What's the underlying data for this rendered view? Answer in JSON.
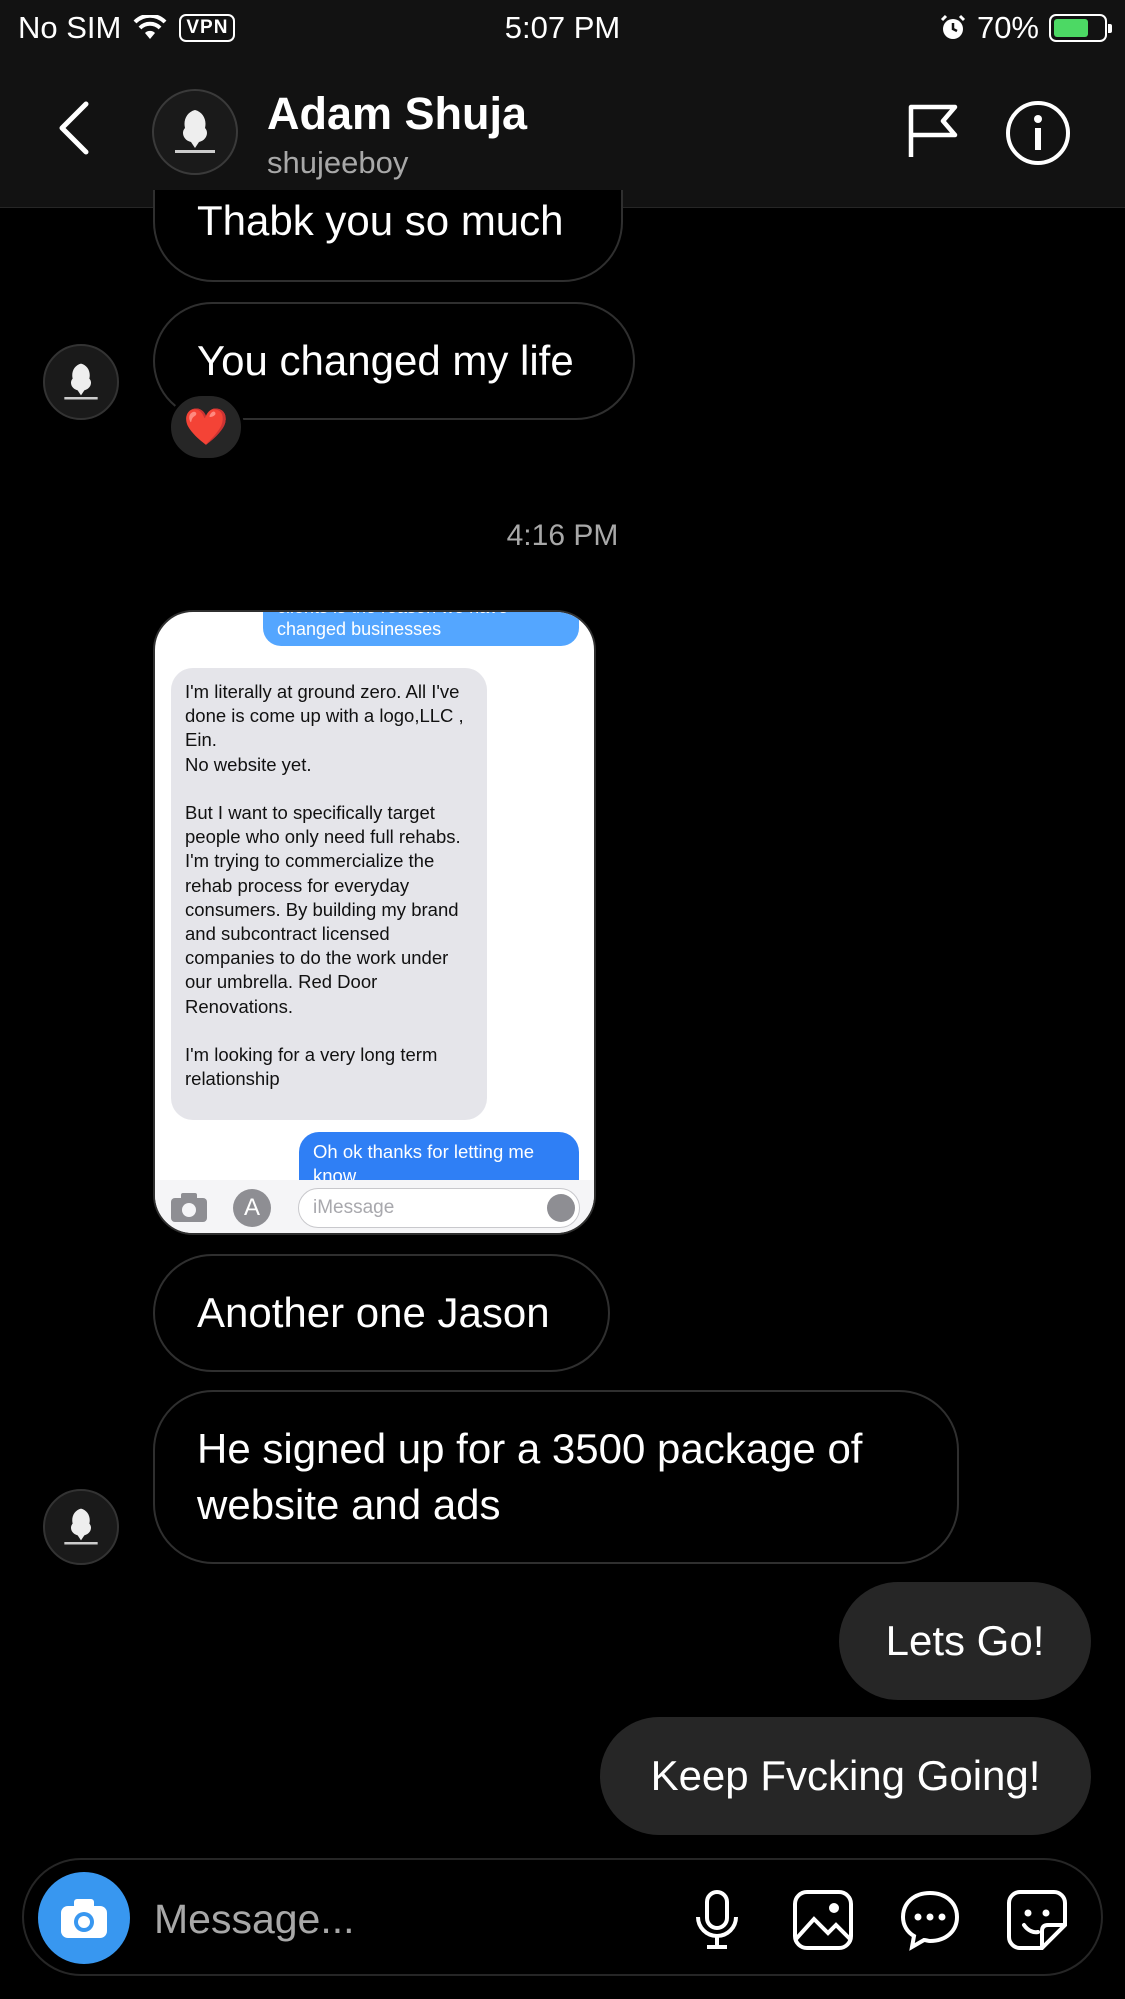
{
  "status_bar": {
    "carrier": "No SIM",
    "vpn": "VPN",
    "time": "5:07 PM",
    "battery": "70%",
    "battery_level": 0.7
  },
  "header": {
    "name": "Adam Shuja",
    "username": "shujeeboy"
  },
  "messages": {
    "m1": "Thabk you so much",
    "m2": "You changed my life",
    "reaction": "❤️",
    "timestamp": "4:16 PM",
    "m3": "Another one Jason",
    "m4": "He signed up for a 3500 package of website and ads",
    "out1": "Lets Go!",
    "out2": "Keep Fvcking Going!"
  },
  "attachment": {
    "top_bubble": "clients is the reason we have changed businesses",
    "gray_bubble": "I'm literally at ground zero. All I've done is come up with a logo,LLC , Ein.\nNo website yet.\n\nBut I want to specifically target people who only need full rehabs. I'm trying to commercialize the rehab process for everyday consumers. By building my brand and subcontract licensed companies to do the work under our umbrella. Red Door Renovations.\n\nI'm looking for a very long term relationship",
    "bottom_bubble": "Oh ok thanks for letting me know",
    "input_placeholder": "iMessage"
  },
  "composer": {
    "placeholder": "Message..."
  },
  "colors": {
    "camera_button": "#3897f0",
    "outgoing_bubble": "#262626",
    "imessage_blue": "#2f7ff5",
    "battery_green": "#4cd964"
  }
}
